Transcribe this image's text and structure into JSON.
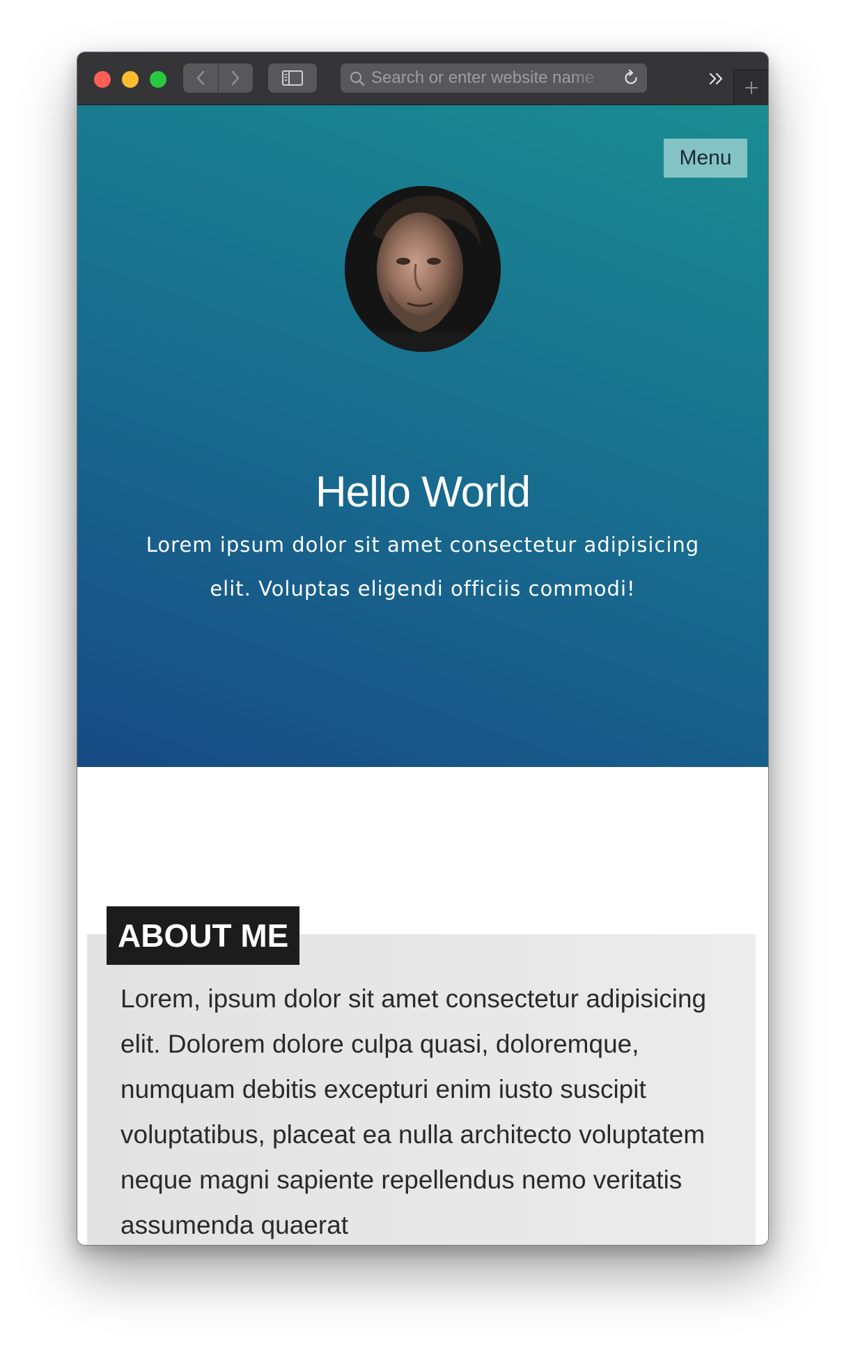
{
  "browser": {
    "address_placeholder": "Search or enter website name"
  },
  "header": {
    "menu_label": "Menu"
  },
  "hero": {
    "title": "Hello World",
    "text": "Lorem ipsum dolor sit amet consectetur adipisicing elit. Voluptas eligendi officiis commodi!"
  },
  "about": {
    "heading": "ABOUT ME",
    "text": "Lorem, ipsum dolor sit amet consectetur adipisicing elit. Dolorem dolore culpa quasi, doloremque, numquam debitis excepturi enim iusto suscipit voluptatibus, placeat ea nulla architecto voluptatem neque magni sapiente repellendus nemo veritatis assumenda quaerat"
  },
  "colors": {
    "hero_gradient_start": "#174a84",
    "hero_gradient_end": "#1a8c91",
    "menu_button_bg": "#84c3c4",
    "about_heading_bg": "#1c1c1c",
    "about_panel_bg": "#e6e6e6"
  },
  "icons": {
    "back": "chevron-left-icon",
    "forward": "chevron-right-icon",
    "sidebar": "sidebar-icon",
    "search": "search-icon",
    "reload": "reload-icon",
    "overflow": "double-chevron-right-icon",
    "new_tab": "plus-icon"
  }
}
